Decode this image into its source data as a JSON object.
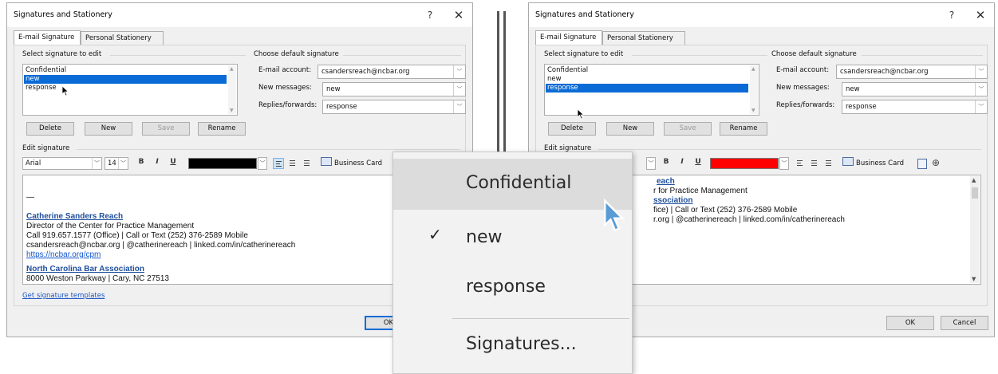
{
  "left_dialog": {
    "title": "Signatures and Stationery",
    "help_glyph": "?",
    "close_glyph": "✕",
    "tabs": [
      {
        "label": "E-mail Signature",
        "active": true
      },
      {
        "label": "Personal Stationery",
        "active": false
      }
    ],
    "select_label": "Select signature to edit",
    "signatures": [
      "Confidential",
      "new",
      "response"
    ],
    "selected_signature": "new",
    "buttons": {
      "delete": "Delete",
      "new": "New",
      "save": "Save",
      "rename": "Rename"
    },
    "default_label": "Choose default signature",
    "email_account_label": "E-mail account:",
    "email_account_value": "csandersreach@ncbar.org",
    "new_messages_label": "New messages:",
    "new_messages_value": "new",
    "replies_label": "Replies/forwards:",
    "replies_value": "response",
    "edit_label": "Edit signature",
    "font": "Arial",
    "font_size": "14",
    "font_color": "#000000",
    "business_card": "Business Card",
    "signature_text": {
      "dash": "—",
      "name": "Catherine Sanders Reach",
      "title": "Director of the Center for Practice Management",
      "phone": "Call 919.657.1577 (Office) | Call or Text (252) 376-2589 Mobile",
      "email": "csandersreach@ncbar.org",
      "sep1": " | ",
      "twitter": "@catherinereach",
      "sep2": " | ",
      "linkedin": "linked.com/in/catherinereach",
      "site": "https://ncbar.org/cpm",
      "org": "North Carolina Bar Association",
      "address": "8000 Weston Parkway | Cary, NC 27513"
    },
    "templates_link": "Get signature templates",
    "ok": "OK"
  },
  "right_dialog": {
    "title": "Signatures and Stationery",
    "help_glyph": "?",
    "close_glyph": "✕",
    "tabs": [
      {
        "label": "E-mail Signature",
        "active": true
      },
      {
        "label": "Personal Stationery",
        "active": false
      }
    ],
    "select_label": "Select signature to edit",
    "signatures": [
      "Confidential",
      "new",
      "response"
    ],
    "selected_signature": "response",
    "buttons": {
      "delete": "Delete",
      "new": "New",
      "save": "Save",
      "rename": "Rename"
    },
    "default_label": "Choose default signature",
    "email_account_label": "E-mail account:",
    "email_account_value": "csandersreach@ncbar.org",
    "new_messages_label": "New messages:",
    "new_messages_value": "new",
    "replies_label": "Replies/forwards:",
    "replies_value": "response",
    "edit_label": "Edit signature",
    "font_color": "#ff0000",
    "business_card": "Business Card",
    "signature_text": {
      "line1": "each",
      "line2": "r for Practice Management",
      "line3": "ssociation",
      "line4": "fice) | Call or Text (252) 376-2589 Mobile",
      "line5a": "r.org",
      "line5b": " | ",
      "line5c": "@catherinereach",
      "line5d": " | ",
      "line5e": "linked.com/in/catherinereach"
    },
    "ok": "OK",
    "cancel": "Cancel"
  },
  "signature_menu": {
    "items": [
      {
        "label": "Confidential",
        "checked": false,
        "hover": true
      },
      {
        "label": "new",
        "checked": true,
        "hover": false
      },
      {
        "label": "response",
        "checked": false,
        "hover": false
      }
    ],
    "check_glyph": "✓",
    "footer": "Signatures..."
  },
  "colors": {
    "selection": "#0a6bd6",
    "link": "#1155cc",
    "heading_link": "#1f4e9c",
    "cursor": "#5b9bd5"
  }
}
